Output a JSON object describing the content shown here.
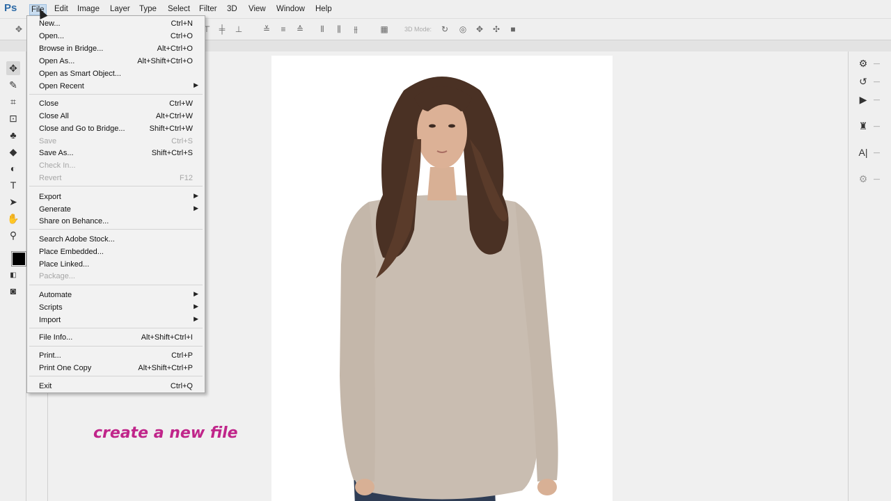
{
  "app": {
    "logo": "Ps",
    "menus": [
      "File",
      "Edit",
      "Image",
      "Layer",
      "Type",
      "Select",
      "Filter",
      "3D",
      "View",
      "Window",
      "Help"
    ]
  },
  "options_bar": {
    "mode_label": "3D Mode:"
  },
  "file_menu": {
    "items": [
      {
        "label": "New...",
        "shortcut": "Ctrl+N"
      },
      {
        "label": "Open...",
        "shortcut": "Ctrl+O"
      },
      {
        "label": "Browse in Bridge...",
        "shortcut": "Alt+Ctrl+O"
      },
      {
        "label": "Open As...",
        "shortcut": "Alt+Shift+Ctrl+O"
      },
      {
        "label": "Open as Smart Object...",
        "shortcut": ""
      },
      {
        "label": "Open Recent",
        "shortcut": ""
      },
      {
        "label": "Close",
        "shortcut": "Ctrl+W"
      },
      {
        "label": "Close All",
        "shortcut": "Alt+Ctrl+W"
      },
      {
        "label": "Close and Go to Bridge...",
        "shortcut": "Shift+Ctrl+W"
      },
      {
        "label": "Save",
        "shortcut": "Ctrl+S"
      },
      {
        "label": "Save As...",
        "shortcut": "Shift+Ctrl+S"
      },
      {
        "label": "Check In...",
        "shortcut": ""
      },
      {
        "label": "Revert",
        "shortcut": "F12"
      },
      {
        "label": "Export",
        "shortcut": ""
      },
      {
        "label": "Generate",
        "shortcut": ""
      },
      {
        "label": "Share on Behance...",
        "shortcut": ""
      },
      {
        "label": "Search Adobe Stock...",
        "shortcut": ""
      },
      {
        "label": "Place Embedded...",
        "shortcut": ""
      },
      {
        "label": "Place Linked...",
        "shortcut": ""
      },
      {
        "label": "Package...",
        "shortcut": ""
      },
      {
        "label": "Automate",
        "shortcut": ""
      },
      {
        "label": "Scripts",
        "shortcut": ""
      },
      {
        "label": "Import",
        "shortcut": ""
      },
      {
        "label": "File Info...",
        "shortcut": "Alt+Shift+Ctrl+I"
      },
      {
        "label": "Print...",
        "shortcut": "Ctrl+P"
      },
      {
        "label": "Print One Copy",
        "shortcut": "Alt+Shift+Ctrl+P"
      },
      {
        "label": "Exit",
        "shortcut": "Ctrl+Q"
      }
    ]
  },
  "caption": "create a new file"
}
